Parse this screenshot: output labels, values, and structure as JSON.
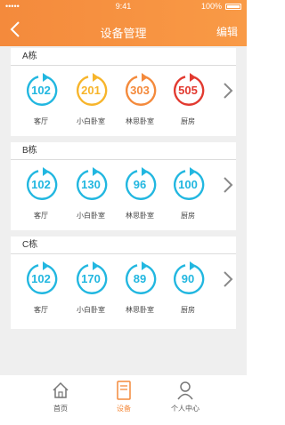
{
  "status": {
    "signal": "•••••",
    "time": "9:41",
    "battery": "100%"
  },
  "nav": {
    "title": "设备管理",
    "edit": "编辑"
  },
  "colors": {
    "accent": "#f48a3c",
    "cyan": "#22b7e0",
    "yellow": "#f7b52b",
    "orange": "#f48a3c",
    "red": "#e23a30"
  },
  "sections": [
    {
      "name": "A栋",
      "rooms": [
        {
          "value": "102",
          "label": "客厅",
          "color": "#22b7e0"
        },
        {
          "value": "201",
          "label": "小白卧室",
          "color": "#f7b52b"
        },
        {
          "value": "303",
          "label": "林思卧室",
          "color": "#f48a3c"
        },
        {
          "value": "505",
          "label": "厨房",
          "color": "#e23a30"
        }
      ]
    },
    {
      "name": "B栋",
      "rooms": [
        {
          "value": "102",
          "label": "客厅",
          "color": "#22b7e0"
        },
        {
          "value": "130",
          "label": "小白卧室",
          "color": "#22b7e0"
        },
        {
          "value": "96",
          "label": "林思卧室",
          "color": "#22b7e0"
        },
        {
          "value": "100",
          "label": "厨房",
          "color": "#22b7e0"
        }
      ]
    },
    {
      "name": "C栋",
      "rooms": [
        {
          "value": "102",
          "label": "客厅",
          "color": "#22b7e0"
        },
        {
          "value": "170",
          "label": "小白卧室",
          "color": "#22b7e0"
        },
        {
          "value": "89",
          "label": "林思卧室",
          "color": "#22b7e0"
        },
        {
          "value": "90",
          "label": "厨房",
          "color": "#22b7e0"
        }
      ]
    }
  ],
  "tabs": [
    {
      "label": "首页",
      "icon": "home-icon"
    },
    {
      "label": "设备",
      "icon": "device-icon"
    },
    {
      "label": "个人中心",
      "icon": "person-icon"
    }
  ]
}
